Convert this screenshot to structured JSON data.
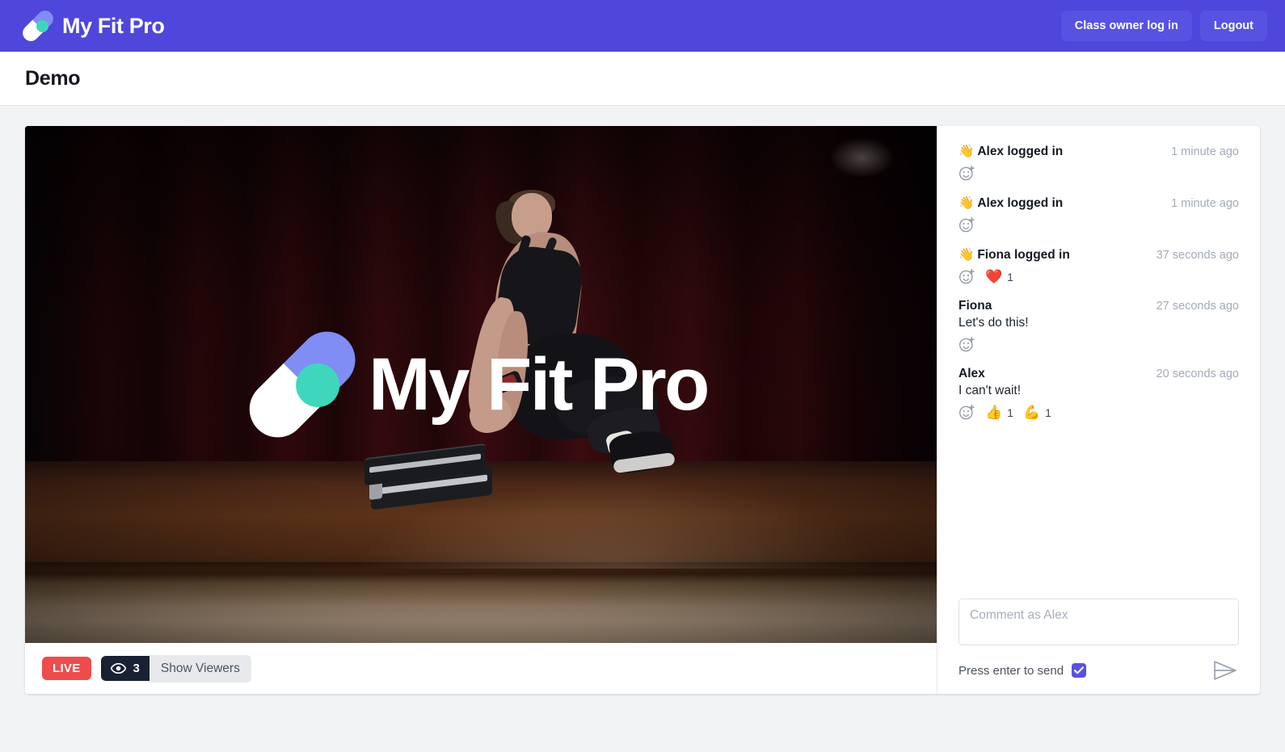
{
  "navbar": {
    "brand_name": "My Fit Pro",
    "brand_icon": "capsule-logo-icon",
    "buttons": [
      {
        "label": "Class owner log in",
        "name": "class-owner-login-button"
      },
      {
        "label": "Logout",
        "name": "logout-button"
      }
    ]
  },
  "page": {
    "title": "Demo"
  },
  "video": {
    "overlay_wordmark": "My Fit Pro",
    "live_label": "LIVE",
    "viewer_icon": "eye-icon",
    "viewer_count": "3",
    "show_viewers_label": "Show Viewers"
  },
  "chat": {
    "messages": [
      {
        "author": "Alex logged in",
        "prefix_emoji": "👋",
        "time": "1 minute ago",
        "body": "",
        "reactions": []
      },
      {
        "author": "Alex logged in",
        "prefix_emoji": "👋",
        "time": "1 minute ago",
        "body": "",
        "reactions": []
      },
      {
        "author": "Fiona logged in",
        "prefix_emoji": "👋",
        "time": "37 seconds ago",
        "body": "",
        "reactions": [
          {
            "emoji": "❤️",
            "count": "1"
          }
        ]
      },
      {
        "author": "Fiona",
        "prefix_emoji": "",
        "time": "27 seconds ago",
        "body": "Let's do this!",
        "reactions": []
      },
      {
        "author": "Alex",
        "prefix_emoji": "",
        "time": "20 seconds ago",
        "body": "I can't wait!",
        "reactions": [
          {
            "emoji": "👍",
            "count": "1"
          },
          {
            "emoji": "💪",
            "count": "1"
          }
        ]
      }
    ],
    "composer": {
      "placeholder": "Comment as Alex",
      "value": "",
      "enter_to_send_label": "Press enter to send",
      "enter_to_send_checked": true,
      "send_icon": "send-paper-plane-icon"
    }
  },
  "colors": {
    "brand_purple": "#4f46dc",
    "button_purple": "#5852e2",
    "live_red": "#ef4b4b",
    "viewer_dark": "#182234",
    "logo_blue": "#7f8df4",
    "logo_teal": "#3fd7bb",
    "page_bg": "#f1f3f5"
  }
}
